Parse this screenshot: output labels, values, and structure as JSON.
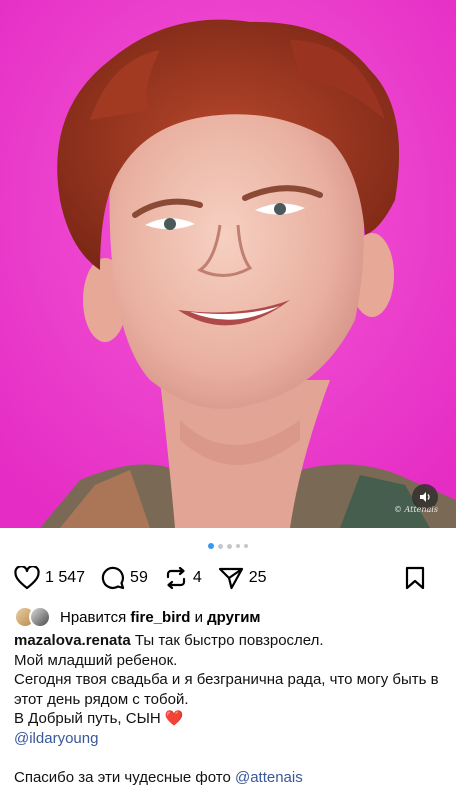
{
  "post": {
    "photo_watermark": "© Attenais",
    "carousel": {
      "count": 5,
      "active": 0
    }
  },
  "actions": {
    "likes": "1 547",
    "comments": "59",
    "reposts": "4",
    "shares": "25"
  },
  "liked_by": {
    "prefix": "Нравится",
    "user": "fire_bird",
    "middle": "и",
    "others": "другим"
  },
  "caption": {
    "username": "mazalova.renata",
    "line1": "Ты так быстро повзрослел.",
    "line2": "Мой младший ребенок.",
    "line3": "Сегодня твоя свадьба и я безгранична рада, что могу быть в этот день рядом с тобой.",
    "line4": "В Добрый путь, СЫН",
    "heart": "❤️",
    "mention1": "@ildaryoung",
    "line5": "Спасибо за эти чудесные фото",
    "mention2": "@attenais"
  },
  "colors": {
    "background_magenta": "#f13fd0",
    "link": "#385898",
    "carousel_active": "#3897f0"
  },
  "icons": [
    "heart-icon",
    "comment-icon",
    "repost-icon",
    "share-icon",
    "bookmark-icon",
    "sound-icon"
  ]
}
